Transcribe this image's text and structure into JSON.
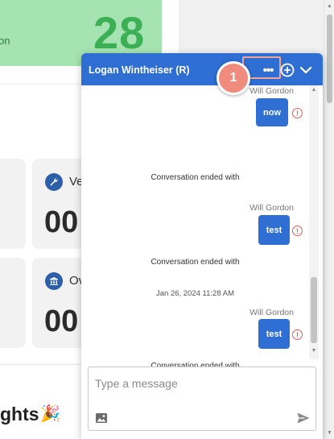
{
  "dashboard": {
    "green_card": {
      "subtext": "on",
      "value": "28"
    },
    "cards": [
      {
        "label": "Ve",
        "value": "00"
      },
      {
        "label": "Ov",
        "value": "00"
      }
    ],
    "section_heading": "ghts",
    "party_emoji": "🎉"
  },
  "chat": {
    "title": "Logan Wintheiser (R)",
    "header_buttons": {
      "more": "•••",
      "add_icon": "plus-circle-icon",
      "collapse_icon": "chevron-down-icon"
    },
    "step_marker": "1",
    "messages": [
      {
        "sender": "Will Gordon",
        "text": "now",
        "status_icon": "error-icon"
      },
      {
        "system": "Conversation ended with"
      },
      {
        "sender": "Will Gordon",
        "text": "test",
        "status_icon": "error-icon"
      },
      {
        "system": "Conversation ended with"
      },
      {
        "date": "Jan 26, 2024 11:28 AM"
      },
      {
        "sender": "Will Gordon",
        "text": "test",
        "status_icon": "error-icon"
      },
      {
        "system": "Conversation ended with"
      }
    ],
    "composer": {
      "placeholder": "Type a message",
      "image_icon": "image-icon",
      "send_icon": "send-icon"
    }
  },
  "colors": {
    "header_blue": "#2f6ed3",
    "bubble_blue": "#2f6ed3",
    "error_red": "#e05a5a",
    "highlight_salmon": "#f08c7e",
    "dashboard_green": "#a6e3b2",
    "dashboard_green_text": "#3cb054"
  }
}
